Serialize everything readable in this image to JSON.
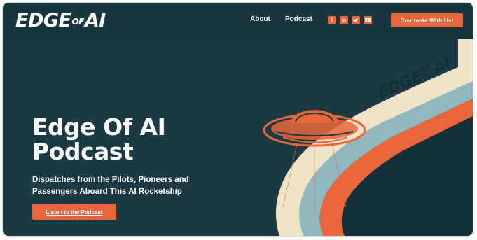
{
  "header": {
    "logo_left": "EDGE",
    "logo_of": "OF",
    "logo_right": "AI",
    "nav": [
      {
        "label": "About"
      },
      {
        "label": "Podcast"
      }
    ],
    "social_icons": [
      "facebook-icon",
      "linkedin-icon",
      "twitter-icon",
      "youtube-icon"
    ],
    "cta_label": "Co-create With Us!"
  },
  "hero": {
    "title_line1": "Edge Of AI",
    "title_line2": "Podcast",
    "subtitle_line1": "Dispatches from the Pilots, Pioneers and",
    "subtitle_line2": "Passengers Aboard This AI Rocketship",
    "button_label": "Listen to the Podcast"
  },
  "artwork": {
    "sign_left": "EDGE",
    "sign_of": "OF",
    "sign_right": "AI"
  },
  "colors": {
    "background": "#1b3a44",
    "accent": "#e8663a",
    "stripe_cream": "#efe3c8",
    "stripe_blue": "#8fb8bf",
    "stripe_orange": "#e8663a"
  }
}
